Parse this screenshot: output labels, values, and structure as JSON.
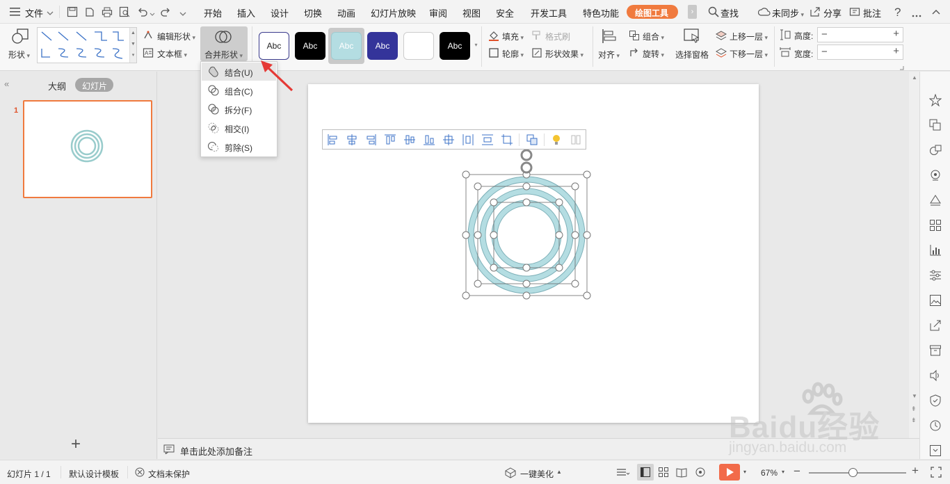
{
  "menubar": {
    "file_label": "文件",
    "tabs": [
      "开始",
      "插入",
      "设计",
      "切换",
      "动画",
      "幻灯片放映",
      "审阅",
      "视图",
      "安全",
      "开发工具",
      "特色功能",
      "绘图工具"
    ],
    "active_tab": "绘图工具",
    "search_label": "查找",
    "sync_label": "未同步",
    "share_label": "分享",
    "comment_label": "批注",
    "accent_color": "#f07a3e"
  },
  "ribbon": {
    "shape_label": "形状",
    "edit_shape_label": "编辑形状",
    "textbox_label": "文本框",
    "merge_shape_label": "合并形状",
    "style_swatches": [
      {
        "text": "Abc",
        "bg": "#ffffff",
        "fg": "#222222",
        "border": "#3a3a8c"
      },
      {
        "text": "Abc",
        "bg": "#000000",
        "fg": "#ffffff",
        "border": "#000000"
      },
      {
        "text": "Abc",
        "bg": "#b4dde2",
        "fg": "#ffffff",
        "border": "#9fcad0"
      },
      {
        "text": "Abc",
        "bg": "#34349a",
        "fg": "#ffffff",
        "border": "#34349a"
      },
      {
        "text": "",
        "bg": "#ffffff",
        "fg": "#222222",
        "border": "#cccccc"
      },
      {
        "text": "Abc",
        "bg": "#000000",
        "fg": "#ffffff",
        "border": "#000000"
      }
    ],
    "fill_label": "填充",
    "format_brush_label": "格式刷",
    "outline_label": "轮廓",
    "shape_effect_label": "形状效果",
    "align_label": "对齐",
    "group_label": "组合",
    "rotate_label": "旋转",
    "selection_pane_label": "选择窗格",
    "bring_forward_label": "上移一层",
    "send_backward_label": "下移一层",
    "height_label": "高度:",
    "width_label": "宽度:"
  },
  "dropdown": {
    "items": [
      {
        "label": "结合(U)",
        "icon": "union-icon"
      },
      {
        "label": "组合(C)",
        "icon": "combine-icon"
      },
      {
        "label": "拆分(F)",
        "icon": "fragment-icon"
      },
      {
        "label": "相交(I)",
        "icon": "intersect-icon"
      },
      {
        "label": "剪除(S)",
        "icon": "subtract-icon"
      }
    ],
    "highlighted": 0
  },
  "leftpanel": {
    "outline_tab": "大纲",
    "slides_tab": "幻灯片",
    "slide_number": "1",
    "add_label": "+"
  },
  "notes": {
    "placeholder": "单击此处添加备注"
  },
  "statusbar": {
    "slide_counter": "幻灯片 1 / 1",
    "template": "默认设计模板",
    "protection": "文档未保护",
    "beautify": "一键美化",
    "zoom": "67%",
    "zoom_level": 0.45
  },
  "watermark": {
    "brand": "Baidu经验",
    "url": "jingyan.baidu.com"
  },
  "colors": {
    "ring_fill": "#b4dde2",
    "ring_stroke": "#7fb1b9",
    "selection": "#f07a3e",
    "arrow": "#e53935",
    "play": "#f26b4a"
  }
}
